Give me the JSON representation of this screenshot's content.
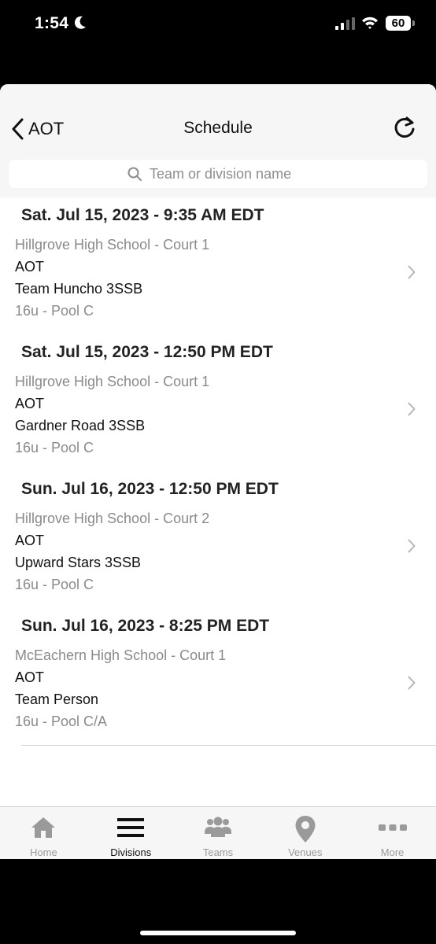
{
  "status_bar": {
    "time": "1:54",
    "battery": "60"
  },
  "nav": {
    "back_label": "AOT",
    "title": "Schedule"
  },
  "search": {
    "placeholder": "Team or division name"
  },
  "schedule": [
    {
      "datetime": "Sat. Jul 15, 2023 - 9:35 AM EDT",
      "venue": "Hillgrove High School - Court 1",
      "team1": "AOT",
      "team2": "Team Huncho 3SSB",
      "division": "16u - Pool C"
    },
    {
      "datetime": "Sat. Jul 15, 2023 - 12:50 PM EDT",
      "venue": "Hillgrove High School - Court 1",
      "team1": "AOT",
      "team2": "Gardner Road 3SSB",
      "division": "16u - Pool C"
    },
    {
      "datetime": "Sun. Jul 16, 2023 - 12:50 PM EDT",
      "venue": "Hillgrove High School - Court 2",
      "team1": "AOT",
      "team2": "Upward Stars 3SSB",
      "division": "16u - Pool C"
    },
    {
      "datetime": "Sun. Jul 16, 2023 - 8:25 PM EDT",
      "venue": "McEachern High School - Court 1",
      "team1": "AOT",
      "team2": "Team Person",
      "division": "16u - Pool C/A"
    }
  ],
  "tabs": [
    {
      "label": "Home",
      "icon": "home-icon",
      "active": false
    },
    {
      "label": "Divisions",
      "icon": "divisions-icon",
      "active": true
    },
    {
      "label": "Teams",
      "icon": "teams-icon",
      "active": false
    },
    {
      "label": "Venues",
      "icon": "venue-pin-icon",
      "active": false
    },
    {
      "label": "More",
      "icon": "more-icon",
      "active": false
    }
  ],
  "colors": {
    "active_tab": "#111111",
    "inactive_tab": "#9a9a9a",
    "secondary_text": "#8a8a8a"
  }
}
